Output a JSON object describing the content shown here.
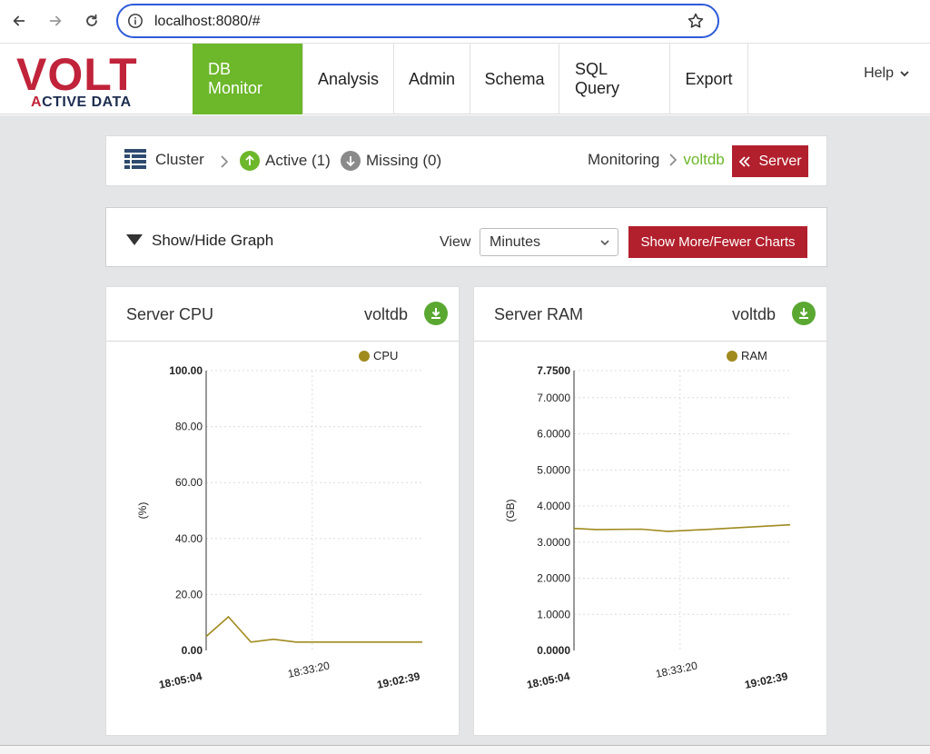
{
  "browser": {
    "url": "localhost:8080/#"
  },
  "app": {
    "logo_main": "VOLT",
    "logo_sub_first": "A",
    "logo_sub_rest": "CTIVE DATA",
    "tabs": [
      {
        "label": "DB Monitor",
        "active": true
      },
      {
        "label": "Analysis",
        "active": false
      },
      {
        "label": "Admin",
        "active": false
      },
      {
        "label": "Schema",
        "active": false
      },
      {
        "label": "SQL Query",
        "active": false
      },
      {
        "label": "Export",
        "active": false
      }
    ],
    "help": "Help"
  },
  "cluster": {
    "label": "Cluster",
    "active": "Active (1)",
    "missing": "Missing (0)",
    "monitoring": "Monitoring",
    "server_name": "voltdb",
    "server_button": "Server",
    "colors": {
      "active": "#6cb72a",
      "missing": "#8a8a8a",
      "server_name": "#6cb72a",
      "button": "#b2202d"
    }
  },
  "graph_controls": {
    "toggle_label": "Show/Hide Graph",
    "view_label": "View",
    "view_value": "Minutes",
    "more_button": "Show More/Fewer Charts"
  },
  "charts": {
    "cpu": {
      "title": "Server CPU",
      "server": "voltdb",
      "legend": "CPU"
    },
    "ram": {
      "title": "Server RAM",
      "server": "voltdb",
      "legend": "RAM"
    }
  },
  "chart_data": [
    {
      "type": "line",
      "title": "Server CPU",
      "ylabel": "(%)",
      "ylim": [
        0,
        100
      ],
      "yticks": [
        "0.00",
        "20.00",
        "40.00",
        "60.00",
        "80.00",
        "100.00"
      ],
      "xticks": [
        "18:05:04",
        "18:33:20",
        "19:02:39"
      ],
      "series": [
        {
          "name": "CPU",
          "color": "#a08a1e",
          "x": [
            "18:05:04",
            "18:11:00",
            "18:17:00",
            "18:23:00",
            "18:29:00",
            "18:35:00",
            "18:47:00",
            "19:02:39"
          ],
          "values": [
            5,
            12,
            3,
            4,
            3,
            3,
            3,
            3
          ]
        }
      ],
      "grid": true,
      "legend": "top-right"
    },
    {
      "type": "line",
      "title": "Server RAM",
      "ylabel": "(GB)",
      "ylim": [
        0,
        7.75
      ],
      "yticks": [
        "0.0000",
        "1.0000",
        "2.0000",
        "3.0000",
        "4.0000",
        "5.0000",
        "6.0000",
        "7.0000",
        "7.7500"
      ],
      "xticks": [
        "18:05:04",
        "18:33:20",
        "19:02:39"
      ],
      "series": [
        {
          "name": "RAM",
          "color": "#a08a1e",
          "x": [
            "18:05:04",
            "18:11:00",
            "18:23:00",
            "18:30:00",
            "18:40:00",
            "19:02:39"
          ],
          "values": [
            3.38,
            3.35,
            3.36,
            3.3,
            3.35,
            3.48
          ]
        }
      ],
      "grid": true,
      "legend": "top-right"
    }
  ]
}
